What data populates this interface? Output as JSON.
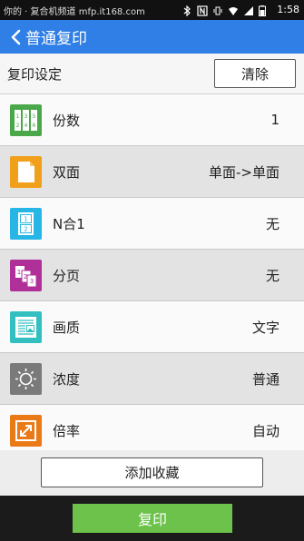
{
  "status_bar": {
    "left_text": "你的 · 复合机频道 mfp.it168.com",
    "time": "1:58",
    "icons": [
      "bluetooth-icon",
      "nfc-icon",
      "vibrate-icon",
      "wifi-icon",
      "signal-icon",
      "battery-icon"
    ]
  },
  "app_bar": {
    "title": "普通复印",
    "back_icon": "chevron-left-icon"
  },
  "settings": {
    "title": "复印设定",
    "clear_label": "清除"
  },
  "rows": [
    {
      "label": "份数",
      "value": "1",
      "icon": "copies-icon",
      "color": "#4aa84a"
    },
    {
      "label": "双面",
      "value": "单面->单面",
      "icon": "duplex-icon",
      "color": "#f0a01a"
    },
    {
      "label": "N合1",
      "value": "无",
      "icon": "n-in-1-icon",
      "color": "#27b6e6"
    },
    {
      "label": "分页",
      "value": "无",
      "icon": "collate-icon",
      "color": "#b0309a"
    },
    {
      "label": "画质",
      "value": "文字",
      "icon": "image-quality-icon",
      "color": "#33bfc0"
    },
    {
      "label": "浓度",
      "value": "普通",
      "icon": "density-icon",
      "color": "#7a7a7a"
    },
    {
      "label": "倍率",
      "value": "自动",
      "icon": "zoom-ratio-icon",
      "color": "#ea7a17"
    }
  ],
  "favorites": {
    "label": "添加收藏"
  },
  "bottom": {
    "copy_label": "复印"
  },
  "colors": {
    "app_bar": "#2f7fe6",
    "copy_button": "#6cc24a"
  }
}
